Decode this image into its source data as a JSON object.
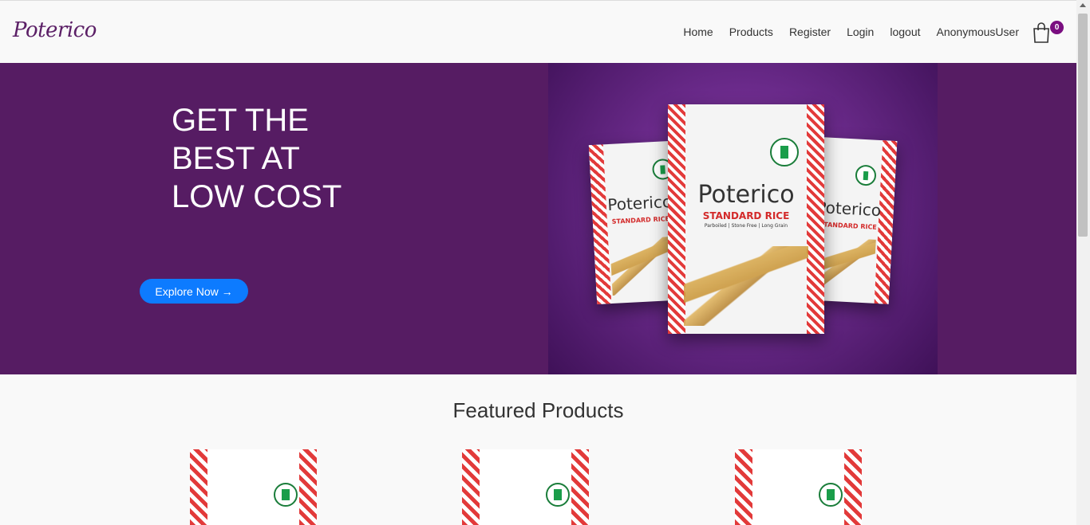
{
  "brand": {
    "logo_text": "Poterico"
  },
  "nav": {
    "links": [
      "Home",
      "Products",
      "Register",
      "Login",
      "logout",
      "AnonymousUser"
    ],
    "cart_icon": "shopping-bag-icon",
    "cart_count": "0"
  },
  "hero": {
    "title": "GET THE BEST AT LOW COST",
    "cta_label": "Explore Now →",
    "image": {
      "bag_brand": "Poterico",
      "bag_product": "STANDARD RICE",
      "bag_description": "Parboiled | Stone Free | Long Grain"
    }
  },
  "featured": {
    "title": "Featured Products"
  },
  "colors": {
    "hero_bg": "#561c63",
    "cta_bg": "#0d7bff",
    "badge_bg": "#7a0e80",
    "logo": "#5b1f66"
  }
}
